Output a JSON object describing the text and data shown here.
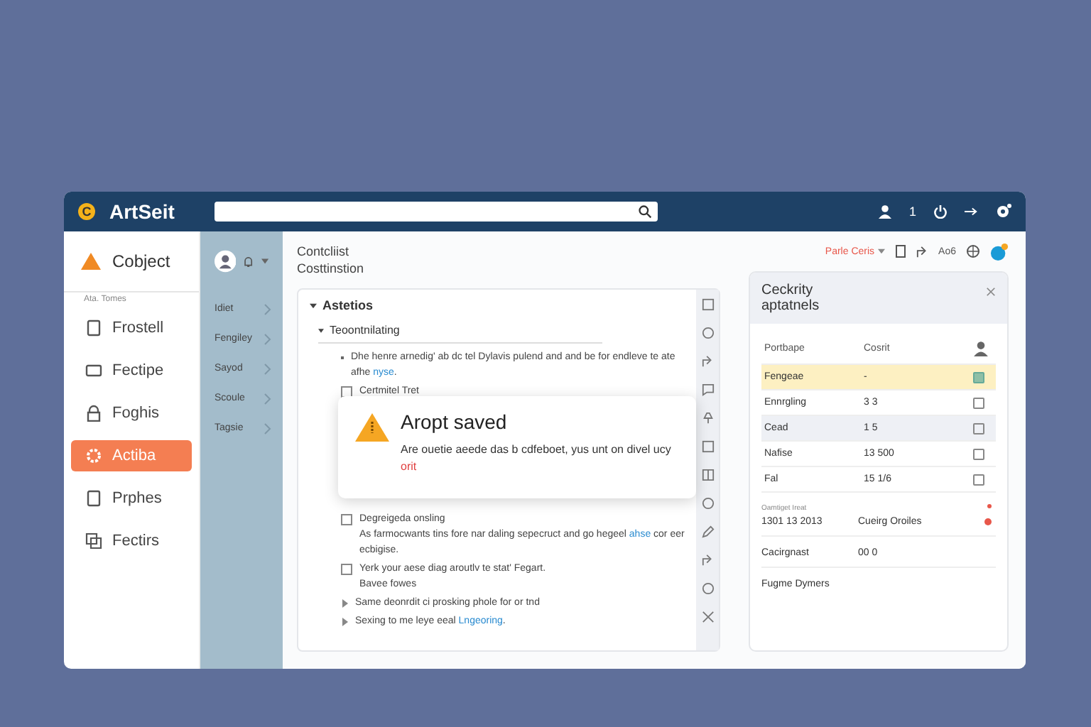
{
  "topbar": {
    "logo": "C",
    "brand": "ArtSeit",
    "count": "1"
  },
  "sidebar": {
    "header": "Cobject",
    "section": "Ata. Tomes",
    "items": [
      {
        "label": "Frostell",
        "selected": false
      },
      {
        "label": "Fectipe",
        "selected": false
      },
      {
        "label": "Foghis",
        "selected": false
      },
      {
        "label": "Actiba",
        "selected": true
      },
      {
        "label": "Prphes",
        "selected": false
      },
      {
        "label": "Fectirs",
        "selected": false
      }
    ]
  },
  "subnav": {
    "items": [
      {
        "label": "Idiet"
      },
      {
        "label": "Fengiley"
      },
      {
        "label": "Sayod"
      },
      {
        "label": "Scoule"
      },
      {
        "label": "Tagsie"
      }
    ]
  },
  "main": {
    "title": [
      "Contcliist",
      "Costtinstion"
    ],
    "outline": [
      {
        "label": "Astetios",
        "expanded": true,
        "children": [
          {
            "label": "Teoontnilating",
            "expanded": true,
            "children": [
              {
                "kind": "bullet",
                "text": "Dhe henre arnedig' ab dc tel Dylavis pulend and and be for endleve te ate afhe",
                "link": "nyse",
                "after": "."
              },
              {
                "kind": "check",
                "checked": false,
                "text": "Certmitel Tret"
              },
              {
                "kind": "check",
                "checked": false,
                "text": "Degreigeda onsling",
                "note": "As farmocwants tins fore nar daling sepecruct and go hegeel",
                "link": "ahse",
                "after": " cor eer ecbigise."
              },
              {
                "kind": "check",
                "checked": false,
                "text": "Yerk your aese diag aroutlv te stat' Fegart.",
                "note": "Bavee fowes"
              },
              {
                "kind": "collapsed",
                "text": "Same deonrdit ci prosking phole for or tnd"
              },
              {
                "kind": "collapsed",
                "text": "Sexing to me leye eeal",
                "link": "Lngeoring",
                "after": "."
              }
            ]
          }
        ]
      }
    ]
  },
  "dialog": {
    "title": "Aropt saved",
    "text": "Are ouetie aeede das b cdfeboet, yus unt on divel ucy",
    "link": "orit"
  },
  "panel": {
    "action": "Parle Ceris",
    "label": "Ao6",
    "card": {
      "title": "Ceckrity aptatnels",
      "columns": [
        "Portbape",
        "Cosrit"
      ],
      "rows": [
        {
          "name": "Fengeae",
          "value": "-",
          "selected": true,
          "checked": true
        },
        {
          "name": "Ennrgling",
          "value": "3 3",
          "selected": false,
          "checked": false
        },
        {
          "name": "Cead",
          "value": "1 5",
          "selected": false,
          "hovered": true,
          "checked": false
        },
        {
          "name": "Nafise",
          "value": "13 500",
          "selected": false,
          "checked": false
        },
        {
          "name": "Fal",
          "value": "15 1/6",
          "selected": false,
          "checked": false
        }
      ],
      "status": {
        "caption": "Oamtiget Ireat",
        "date": "1301 13 2013",
        "state": "Cueirg Oroiles",
        "color": "#e8574a"
      },
      "extra": [
        {
          "name": "Cacirgnast",
          "value": "00 0"
        },
        {
          "name": "Fugme Dymers"
        }
      ]
    }
  }
}
